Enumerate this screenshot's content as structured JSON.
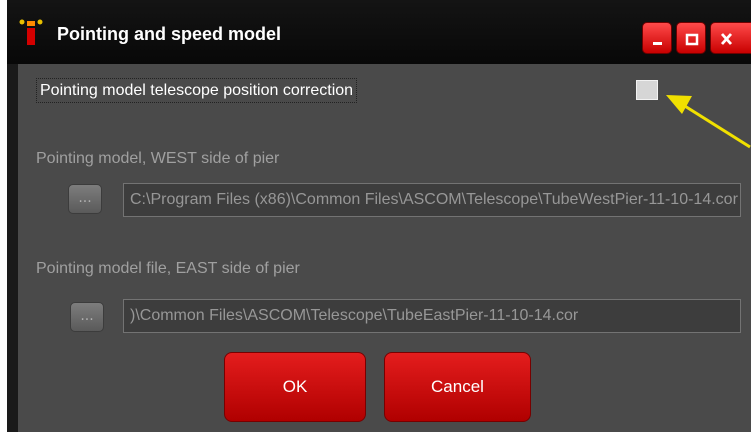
{
  "window": {
    "title": "Pointing and speed model",
    "icon": "app-icon",
    "controls": [
      "minimize-icon",
      "maximize-icon",
      "close-icon"
    ]
  },
  "correction": {
    "label": "Pointing model telescope position correction",
    "checked": false
  },
  "west": {
    "label": "Pointing model, WEST side of pier",
    "browse_label": "...",
    "path": "C:\\Program Files (x86)\\Common Files\\ASCOM\\Telescope\\TubeWestPier-11-10-14.cor"
  },
  "east": {
    "label": "Pointing model file, EAST side of pier",
    "browse_label": "...",
    "path": ")\\Common Files\\ASCOM\\Telescope\\TubeEastPier-11-10-14.cor"
  },
  "buttons": {
    "ok": "OK",
    "cancel": "Cancel"
  },
  "colors": {
    "accent": "#d40000",
    "window_bg": "#4a4a4a",
    "titlebar": "#0e0e0e",
    "annotation_arrow": "#f0e000"
  }
}
